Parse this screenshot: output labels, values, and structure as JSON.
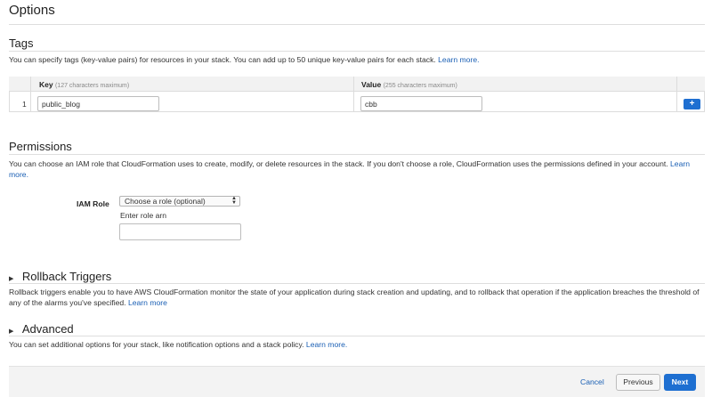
{
  "page": {
    "title": "Options"
  },
  "tags": {
    "title": "Tags",
    "description": "You can specify tags (key-value pairs) for resources in your stack. You can add up to 50 unique key-value pairs for each stack.",
    "learn_more": "Learn more.",
    "columns": {
      "key_label": "Key",
      "key_hint": "(127 characters maximum)",
      "value_label": "Value",
      "value_hint": "(255 characters maximum)"
    },
    "rows": [
      {
        "num": "1",
        "key": "public_blog",
        "value": "cbb"
      }
    ],
    "add_button": "+"
  },
  "permissions": {
    "title": "Permissions",
    "description_line1": "You can choose an IAM role that CloudFormation uses to create, modify, or delete resources in the stack. If you don't choose a role, CloudFormation uses the permissions defined in your account.",
    "learn_part1": "Learn",
    "learn_part2": "more.",
    "iam_role_label": "IAM Role",
    "iam_role_select": "Choose a role (optional)",
    "role_arn_label": "Enter role arn",
    "role_arn_value": ""
  },
  "rollback": {
    "title": "Rollback Triggers",
    "description_line1": "Rollback triggers enable you to have AWS CloudFormation monitor the state of your application during stack creation and updating, and to rollback that operation if the application breaches the",
    "description_line2": "threshold of any of the alarms you've specified.",
    "learn_more": "Learn more"
  },
  "advanced": {
    "title": "Advanced",
    "description": "You can set additional options for your stack, like notification options and a stack policy.",
    "learn_more": "Learn more."
  },
  "footer": {
    "cancel": "Cancel",
    "previous": "Previous",
    "next": "Next"
  },
  "colors": {
    "accent": "#1e6fd1",
    "link": "#1a5fb4"
  },
  "icons": {
    "collapse_caret": "caret-right-icon",
    "select_arrows": "select-arrows-icon"
  }
}
